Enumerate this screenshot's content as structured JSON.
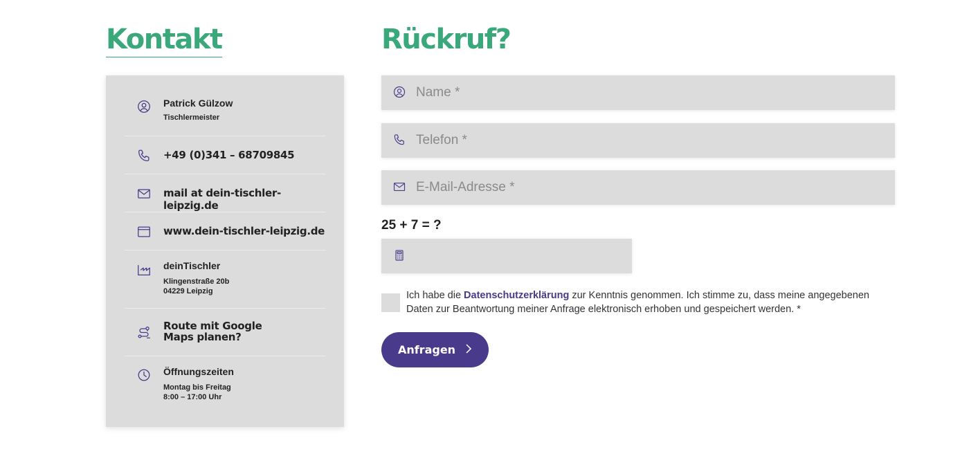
{
  "contact": {
    "heading": "Kontakt",
    "person": {
      "name": "Patrick Gülzow",
      "role": "Tischlermeister",
      "icon": "user-circle-icon"
    },
    "phone": {
      "value": "+49 (0)341 – 68709845",
      "icon": "phone-icon"
    },
    "email": {
      "value": "mail at dein-tischler-leipzig.de",
      "icon": "envelope-icon"
    },
    "website": {
      "value": "www.dein-tischler-leipzig.de",
      "icon": "browser-window-icon"
    },
    "address": {
      "company": "deinTischler",
      "street": "Klingenstraße 20b",
      "city": "04229 Leipzig",
      "icon": "factory-icon"
    },
    "route": {
      "label": "Route mit Google Maps planen?",
      "icon": "route-icon"
    },
    "hours": {
      "title": "Öffnungszeiten",
      "days": "Montag bis Freitag",
      "time": "8:00 – 17:00 Uhr",
      "icon": "clock-icon"
    }
  },
  "callback": {
    "heading": "Rückruf?",
    "name_placeholder": "Name *",
    "phone_placeholder": "Telefon *",
    "email_placeholder": "E-Mail-Adresse *",
    "captcha_label": "25 + 7 = ?",
    "captcha_value": "",
    "consent_before": "Ich habe die ",
    "consent_link": "Datenschutzerklärung",
    "consent_after": " zur Kenntnis genommen. Ich stimme zu, dass meine angegebenen Daten zur Beantwortung meiner Anfrage elektronisch erhoben und gespeichert werden. *",
    "consent_checked": false,
    "submit_label": "Anfragen"
  },
  "colors": {
    "accent_green": "#3aa87a",
    "accent_purple": "#4a3a8c",
    "field_bg": "#dcdcdc"
  }
}
